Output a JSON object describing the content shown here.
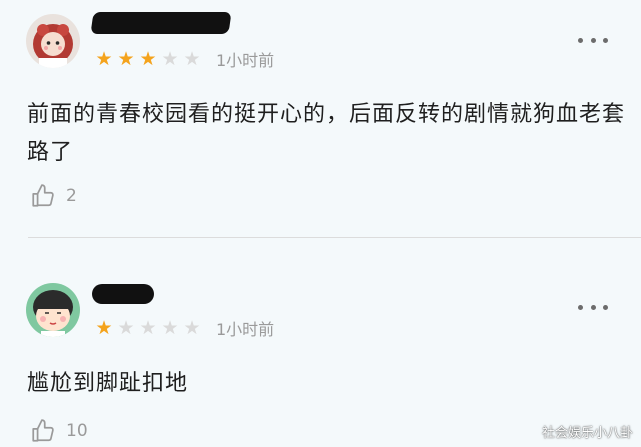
{
  "comments": [
    {
      "avatar_icon": "doll-avatar-icon",
      "username_redacted": true,
      "rating": 3,
      "rating_max": 5,
      "time": "1小时前",
      "content": "前面的青春校园看的挺开心的，后面反转的剧情就狗血老套路了",
      "likes": "2"
    },
    {
      "avatar_icon": "cartoon-girl-avatar-icon",
      "username_redacted": true,
      "rating": 1,
      "rating_max": 5,
      "time": "1小时前",
      "content": "尴尬到脚趾扣地",
      "likes": "10"
    }
  ],
  "watermark": "社会娱乐小八卦",
  "colors": {
    "background": "#f4f9fb",
    "star_on": "#f4a31c",
    "star_off": "#dadada",
    "muted_text": "#9a9a9a"
  }
}
